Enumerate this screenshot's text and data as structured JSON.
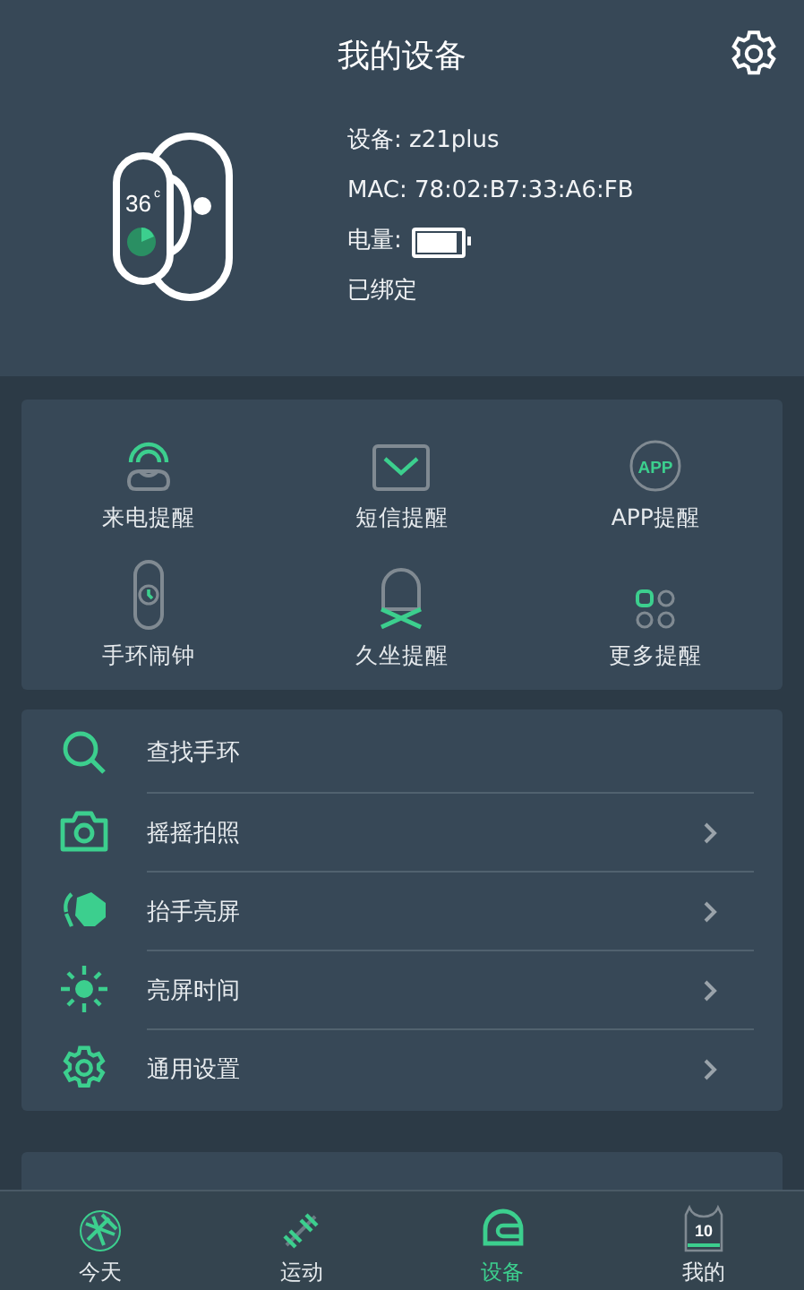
{
  "header": {
    "title": "我的设备"
  },
  "device": {
    "name": "设备: z21plus",
    "mac": "MAC: 78:02:B7:33:A6:FB",
    "battery_label": "电量:",
    "battery": {
      "level": 0.9
    },
    "status": "已绑定",
    "temperature": "36",
    "temperature_unit": "c"
  },
  "reminders": [
    {
      "kind": "call",
      "label": "来电提醒"
    },
    {
      "kind": "sms",
      "label": "短信提醒"
    },
    {
      "kind": "app",
      "label": "APP提醒",
      "icon_text": "APP"
    },
    {
      "kind": "alarm",
      "label": "手环闹钟"
    },
    {
      "kind": "sit",
      "label": "久坐提醒"
    },
    {
      "kind": "more",
      "label": "更多提醒"
    }
  ],
  "menu": [
    {
      "kind": "search",
      "label": "查找手环",
      "arrow": false
    },
    {
      "kind": "camera",
      "label": "摇摇拍照",
      "arrow": true
    },
    {
      "kind": "wrist",
      "label": "抬手亮屏",
      "arrow": true
    },
    {
      "kind": "sun",
      "label": "亮屏时间",
      "arrow": true
    },
    {
      "kind": "gear",
      "label": "通用设置",
      "arrow": true
    }
  ],
  "nav": [
    {
      "kind": "today",
      "label": "今天",
      "selected": false
    },
    {
      "kind": "sport",
      "label": "运动",
      "selected": false
    },
    {
      "kind": "device",
      "label": "设备",
      "selected": true
    },
    {
      "kind": "me",
      "label": "我的",
      "selected": false,
      "icon_text": "10"
    }
  ]
}
